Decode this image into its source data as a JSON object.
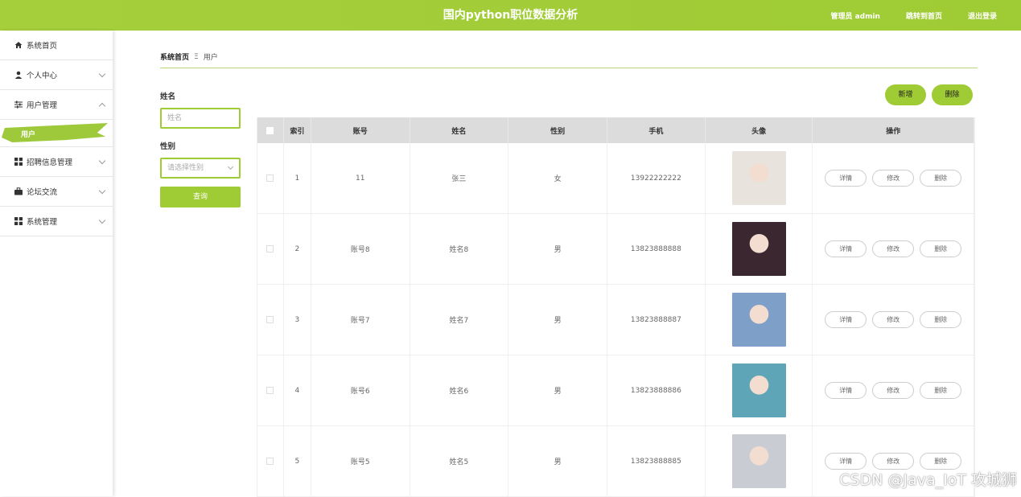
{
  "header": {
    "title": "国内python职位数据分析",
    "user": "管理员 admin",
    "goto_frontend": "跳转到首页",
    "logout": "退出登录"
  },
  "sidebar": {
    "items": [
      {
        "label": "系统首页",
        "icon": "home-icon"
      },
      {
        "label": "个人中心",
        "icon": "user-icon"
      },
      {
        "label": "用户管理",
        "icon": "sliders-icon"
      },
      {
        "label": "招聘信息管理",
        "icon": "grid-icon"
      },
      {
        "label": "论坛交流",
        "icon": "briefcase-icon"
      },
      {
        "label": "系统管理",
        "icon": "grid-icon"
      }
    ],
    "submenu_active": "用户"
  },
  "breadcrumb": {
    "home": "系统首页",
    "sep": "Ξ",
    "current": "用户"
  },
  "search": {
    "name_label": "姓名",
    "name_placeholder": "姓名",
    "gender_label": "性别",
    "gender_placeholder": "请选择性别",
    "query": "查询"
  },
  "actions": {
    "add": "新增",
    "delete": "删除"
  },
  "table": {
    "headers": [
      "索引",
      "账号",
      "姓名",
      "性别",
      "手机",
      "头像",
      "操作"
    ],
    "op_labels": {
      "detail": "详情",
      "edit": "修改",
      "delete": "删除"
    },
    "rows": [
      {
        "index": "1",
        "account": "11",
        "name": "张三",
        "gender": "女",
        "phone": "13922222222",
        "avatar_color": "#e9e3de"
      },
      {
        "index": "2",
        "account": "账号8",
        "name": "姓名8",
        "gender": "男",
        "phone": "13823888888",
        "avatar_color": "#3a2730"
      },
      {
        "index": "3",
        "account": "账号7",
        "name": "姓名7",
        "gender": "男",
        "phone": "13823888887",
        "avatar_color": "#7d9fc8"
      },
      {
        "index": "4",
        "account": "账号6",
        "name": "姓名6",
        "gender": "男",
        "phone": "13823888886",
        "avatar_color": "#5fa5b8"
      },
      {
        "index": "5",
        "account": "账号5",
        "name": "姓名5",
        "gender": "男",
        "phone": "13823888885",
        "avatar_color": "#c9cdd3"
      }
    ]
  },
  "watermark": "CSDN @Java_IoT 攻城狮"
}
